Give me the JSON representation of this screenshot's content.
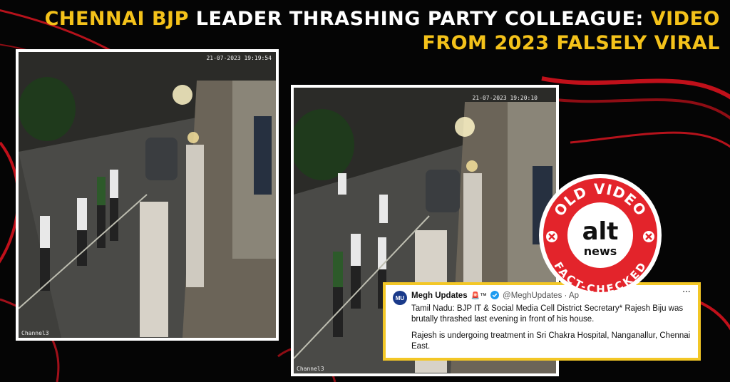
{
  "headline": {
    "part1_yellow": "CHENNAI BJP",
    "part2_white": " LEADER THRASHING PARTY COLLEAGUE: ",
    "part3_yellow_a": "VIDEO",
    "line2_yellow": "FROM 2023 FALSELY VIRAL"
  },
  "frames": [
    {
      "timestamp": "21-07-2023 19:19:54",
      "channel": "Channel3"
    },
    {
      "timestamp": "21-07-2023 19:20:10",
      "channel": "Channel3"
    }
  ],
  "tweet": {
    "avatar_text": "MU",
    "name": "Megh Updates",
    "name_badges": "🚨™",
    "handle": "@MeghUpdates · Ap",
    "more": "···",
    "body_line1": "Tamil Nadu: BJP IT & Social Media Cell District Secretary* Rajesh Biju was brutally thrashed last evening in front of his house.",
    "body_line2": "Rajesh is undergoing treatment in Sri Chakra Hospital, Nanganallur, Chennai East."
  },
  "badge": {
    "top_text": "OLD VIDEO",
    "logo_alt": "alt",
    "logo_news": "news",
    "bottom_text": "FACT-CHECKED"
  },
  "colors": {
    "accent_yellow": "#f4c21a",
    "badge_red": "#e3242b",
    "swoosh_red": "#c0101a"
  }
}
